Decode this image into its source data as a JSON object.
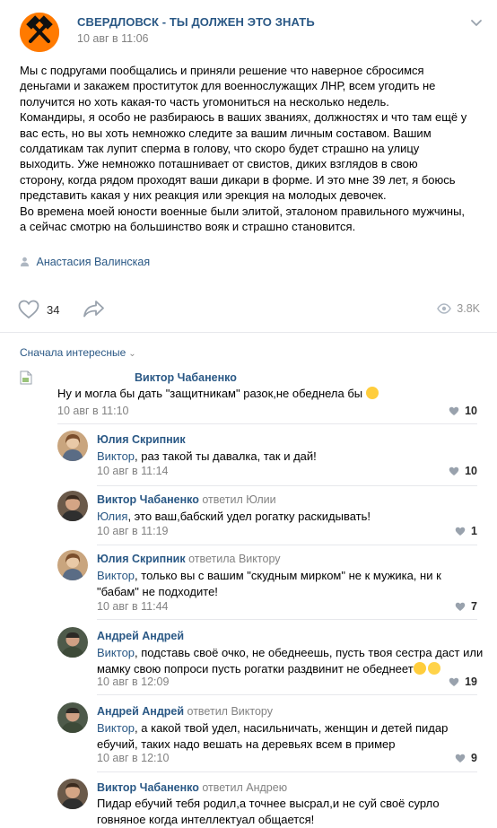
{
  "post": {
    "group_name": "СВЕРДЛОВСК - ТЫ ДОЛЖЕН ЭТО ЗНАТЬ",
    "date": "10 авг в 11:06",
    "text": "Мы с подругами пообщались и приняли решение что наверное сбросимся\nденьгами и закажем проституток для военнослужащих ЛНР, всем угодить не\nполучится но хоть какая-то часть угомониться на несколько недель.\nКомандиры, я особо не разбираюсь в ваших званиях, должностях и что там ещё у\nвас есть, но вы хоть немножко следите за вашим личным составом. Вашим\nсолдатикам так лупит сперма в голову, что скоро будет страшно на улицу\nвыходить. Уже немножко поташнивает от свистов, диких взглядов в свою\nсторону, когда рядом проходят ваши дикари в форме. И это мне 39 лет, я боюсь\nпредставить какая у них реакция или эрекция на молодых девочек.\nВо времена моей юности военные были элитой, эталоном правильного мужчины,\nа сейчас смотрю на большинство вояк и страшно становится.",
    "author": "Анастасия Валинская",
    "likes": "34",
    "views": "3.8K",
    "accent_color": "#2a5885",
    "avatar_color": "#ff7a00"
  },
  "comments_sort": "Сначала интересные",
  "comments": [
    {
      "name": "Виктор Чабаненко",
      "replied": "",
      "addr": "",
      "text": "Ну и могла бы дать \"защитникам\" разок,не обеднела бы",
      "emoji": [
        "grinning"
      ],
      "date": "10 авг в 11:10",
      "likes": "10"
    },
    {
      "name": "Юлия Скрипник",
      "replied": "",
      "addr": "Виктор",
      "text": ", раз такой ты давалка, так и дай!",
      "date": "10 авг в 11:14",
      "likes": "10"
    },
    {
      "name": "Виктор Чабаненко",
      "replied": "ответил Юлии",
      "addr": "Юлия",
      "text": ", это ваш,бабский удел рогатку раскидывать!",
      "date": "10 авг в 11:19",
      "likes": "1"
    },
    {
      "name": "Юлия Скрипник",
      "replied": "ответила Виктору",
      "addr": "Виктор",
      "text": ", только вы с вашим \"скудным мирком\" не к мужика, ни к",
      "text2": "\"бабам\" не подходите!",
      "date": "10 авг в 11:44",
      "likes": "7"
    },
    {
      "name": "Андрей Андрей",
      "replied": "",
      "addr": "Виктор",
      "text": ", подставь своё очко, не обеднеешь, пусть твоя сестра даст или",
      "text2": "мамку свою попроси пусть рогатки раздвинит не обеднеет",
      "emoji": [
        "grinning",
        "sweat"
      ],
      "date": "10 авг в 12:09",
      "likes": "19"
    },
    {
      "name": "Андрей Андрей",
      "replied": "ответил Виктору",
      "addr": "Виктор",
      "text": ", а какой твой удел, насильничать, женщин и детей пидар",
      "text2": "ебучий, таких надо вешать на деревьях всем в пример",
      "date": "10 авг в 12:10",
      "likes": "9"
    },
    {
      "name": "Виктор Чабаненко",
      "replied": "ответил Андрею",
      "addr": "",
      "text": "Пидар ебучий тебя родил,а точнее высрал,и не суй своё сурло",
      "text2": "говняное когда интеллектуал общается!",
      "date": "",
      "likes": ""
    }
  ]
}
